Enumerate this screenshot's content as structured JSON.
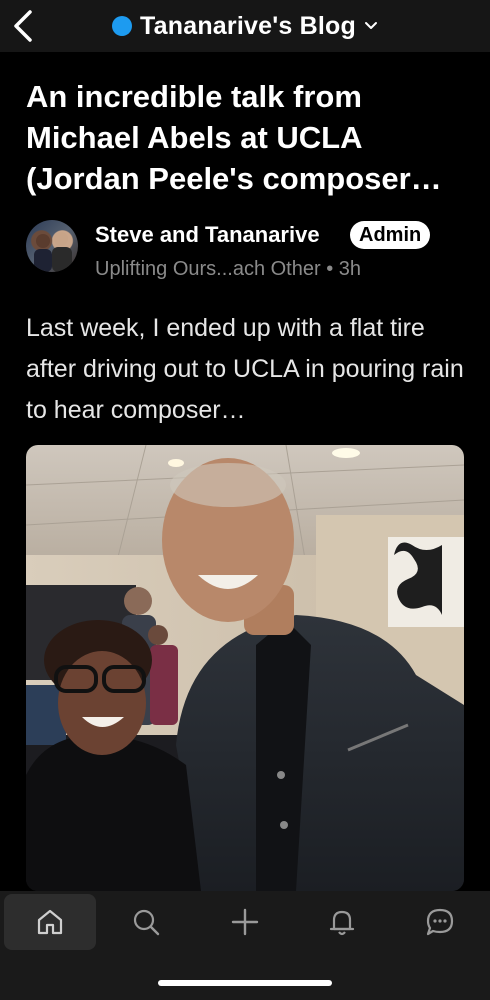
{
  "header": {
    "blog_name": "Tananarive's Blog",
    "accent_color": "#1d9bf0",
    "back_icon": "chevron-left-icon",
    "dropdown_icon": "chevron-down-icon"
  },
  "post": {
    "title": "An incredible talk from Michael Abels at UCLA (Jordan Peele's composer…",
    "author": {
      "name": "Steve and Tananarive",
      "badge": "Admin",
      "community": "Uplifting Ours...ach Other",
      "separator": "•",
      "time": "3h"
    },
    "excerpt": "Last week, I ended up with a flat tire after driving out to UCLA in pouring rain to hear composer…",
    "image_alt": "Two people smiling for a photo in a room"
  },
  "bottom_nav": {
    "items": [
      {
        "icon": "home-icon",
        "active": true
      },
      {
        "icon": "search-icon",
        "active": false
      },
      {
        "icon": "plus-icon",
        "active": false
      },
      {
        "icon": "bell-icon",
        "active": false
      },
      {
        "icon": "chat-icon",
        "active": false
      }
    ]
  }
}
